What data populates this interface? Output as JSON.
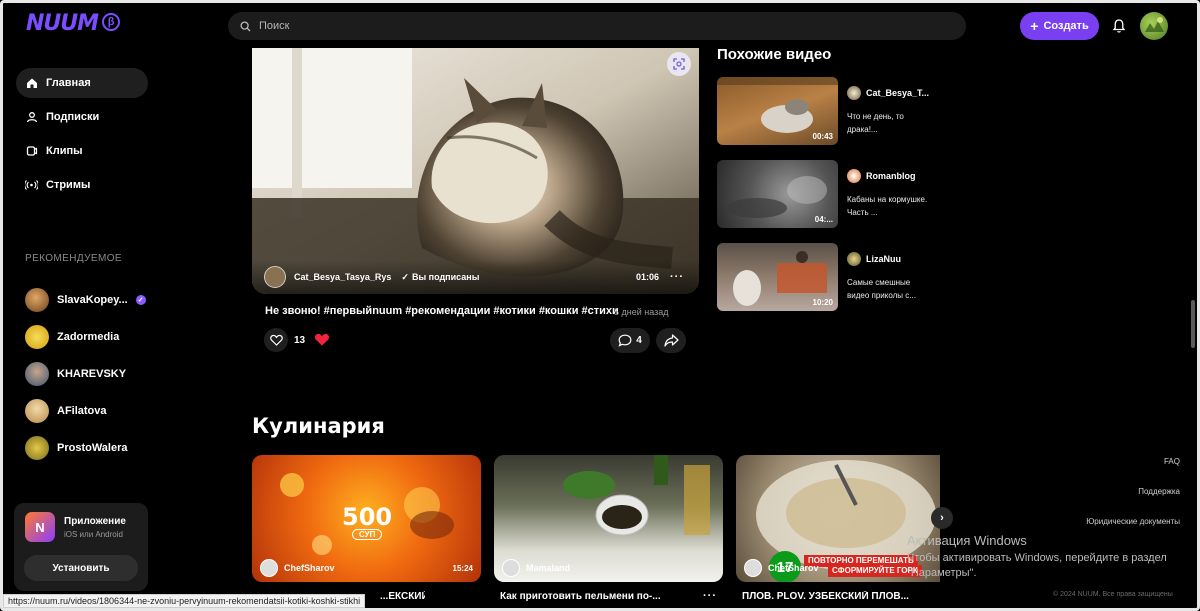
{
  "brand": {
    "name": "NUUM",
    "beta": "β"
  },
  "search": {
    "placeholder": "Поиск"
  },
  "header": {
    "create_label": "Создать"
  },
  "nav": [
    {
      "label": "Главная",
      "icon": "home-icon",
      "active": true
    },
    {
      "label": "Подписки",
      "icon": "subscriptions-icon"
    },
    {
      "label": "Клипы",
      "icon": "clips-icon"
    },
    {
      "label": "Стримы",
      "icon": "streams-icon"
    }
  ],
  "recommended": {
    "title": "РЕКОМЕНДУЕМОЕ",
    "items": [
      {
        "name": "SlavaKopey...",
        "verified": true,
        "color": "#b97a3c"
      },
      {
        "name": "Zadormedia",
        "color": "#e8c02a"
      },
      {
        "name": "KHAREVSKY",
        "color": "#5a7fa8"
      },
      {
        "name": "AFilatova",
        "color": "#d8b070"
      },
      {
        "name": "ProstoWalera",
        "color": "#c9b02a"
      }
    ]
  },
  "app_promo": {
    "title": "Приложение",
    "subtitle": "iOS или Android",
    "button": "Установить",
    "logo": "N"
  },
  "status_url": "https://nuum.ru/videos/1806344-ne-zvoniu-pervyinuum-rekomendatsii-kotiki-koshki-stikhi",
  "player": {
    "author": "Cat_Besya_Tasya_Rys",
    "subscribed": "Вы подписаны",
    "duration": "01:06",
    "more": "···",
    "title": "Не звоню! #первыйnuum #рекомендации #котики #кошки #стихи",
    "date": "5 дней назад",
    "likes": "13",
    "comments": "4"
  },
  "similar": {
    "title": "Похожие видео",
    "items": [
      {
        "author": "Cat_Besya_T...",
        "desc": "Что не день, то драка!...",
        "duration": "00:43"
      },
      {
        "author": "Romanblog",
        "desc": "Кабаны на кормушке. Часть ...",
        "duration": "04:..."
      },
      {
        "author": "LizaNuu",
        "desc": "Самые смешные видео приколы с...",
        "duration": "10:20"
      }
    ]
  },
  "cooking": {
    "title": "Кулинария",
    "cards": [
      {
        "author": "ChefSharov",
        "duration": "15:24",
        "caption": "...ЕКСКИЙ...",
        "overlay": "500",
        "overlay_sub": "СУП"
      },
      {
        "author": "Mamaland",
        "duration": "",
        "caption": "Как приготовить пельмени по-..."
      },
      {
        "author": "ChefSharov",
        "duration": "",
        "caption": "ПЛОВ. PLOV. УЗБЕКСКИЙ ПЛОВ...",
        "badge_number": "17",
        "badge_text_1": "ПОВТОРНО ПЕРЕМЕШАТЬ",
        "badge_text_2": "СФОРМИРУЙТЕ ГОРК"
      }
    ],
    "more": "···"
  },
  "footer": {
    "faq": "FAQ",
    "support": "Поддержка",
    "legal": "Юридические документы",
    "copyright": "© 2024 NUUM. Все права защищены"
  },
  "windows_activation": {
    "title": "Активация Windows",
    "text": "Чтобы активировать Windows, перейдите в раздел \"Параметры\"."
  }
}
